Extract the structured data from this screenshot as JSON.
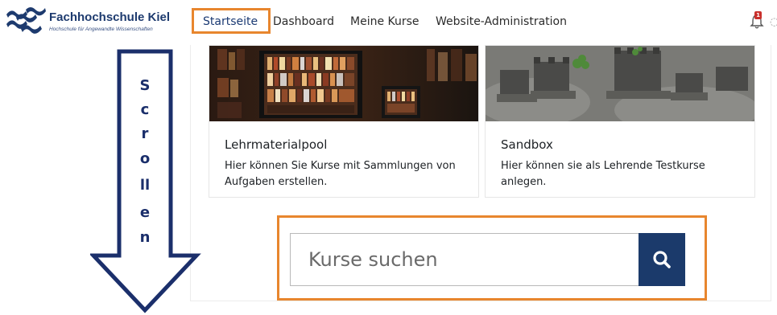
{
  "header": {
    "logo_title": "Fachhochschule Kiel",
    "logo_subtitle": "Hochschule für Angewandte Wissenschaften",
    "nav": [
      {
        "label": "Startseite"
      },
      {
        "label": "Dashboard"
      },
      {
        "label": "Meine Kurse"
      },
      {
        "label": "Website-Administration"
      }
    ],
    "notification_count": "1"
  },
  "cards": [
    {
      "title": "Lehrmaterialpool",
      "text": "Hier können Sie Kurse mit Sammlungen von Aufgaben erstellen."
    },
    {
      "title": "Sandbox",
      "text": "Hier können sie als Lehrende Testkurse anlegen."
    }
  ],
  "search": {
    "placeholder": "Kurse suchen",
    "button_icon": "search-icon"
  },
  "scroll_hint": {
    "letters": [
      "S",
      "c",
      "r",
      "o",
      "ll",
      "e",
      "n"
    ]
  },
  "colors": {
    "highlight": "#e8862e",
    "brand": "#1b3a6b",
    "arrow": "#1b2f6b"
  }
}
